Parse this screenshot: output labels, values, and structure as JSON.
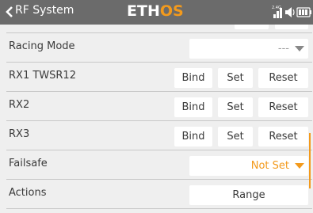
{
  "header": {
    "title": "RF System",
    "logo_part1": "ETH",
    "logo_part2": "OS",
    "status_label": "2.4G"
  },
  "rows": [
    {
      "label": "Racing Mode",
      "dropdown_value": "---"
    },
    {
      "label": "RX1  TWSR12",
      "bind": "Bind",
      "set": "Set",
      "reset": "Reset"
    },
    {
      "label": "RX2",
      "bind": "Bind",
      "set": "Set",
      "reset": "Reset"
    },
    {
      "label": "RX3",
      "bind": "Bind",
      "set": "Set",
      "reset": "Reset"
    },
    {
      "label": "Failsafe",
      "dropdown_value": "Not Set"
    },
    {
      "label": "Actions",
      "range": "Range"
    }
  ],
  "colors": {
    "accent": "#f39a1c",
    "header_bg": "#6b6b6b",
    "background": "#efefef",
    "muted_text": "#999999"
  }
}
